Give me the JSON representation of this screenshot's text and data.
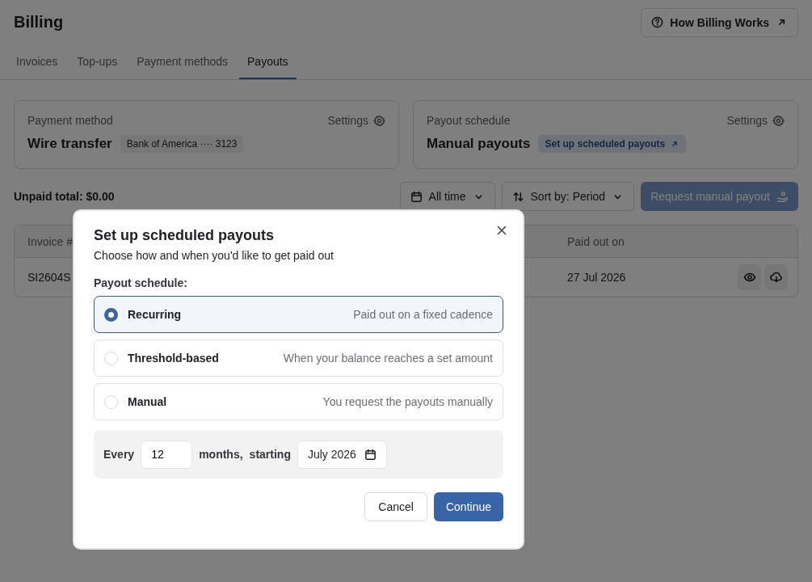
{
  "page": {
    "title": "Billing",
    "help_button": "How Billing Works"
  },
  "tabs": [
    {
      "label": "Invoices",
      "selected": false
    },
    {
      "label": "Top-ups",
      "selected": false
    },
    {
      "label": "Payment methods",
      "selected": false
    },
    {
      "label": "Payouts",
      "selected": true
    }
  ],
  "cards": [
    {
      "label": "Payment method",
      "settings": "Settings",
      "value": "Wire transfer",
      "badge": {
        "text": "Bank of America ···· 3123",
        "kind": "plain"
      }
    },
    {
      "label": "Payout schedule",
      "settings": "Settings",
      "value": "Manual payouts",
      "badge": {
        "text": "Set up scheduled payouts",
        "kind": "link"
      }
    }
  ],
  "toolbar": {
    "unpaid_total": "Unpaid total: $0.00",
    "date_filter": "All time",
    "sort": "Sort by: Period",
    "request_button": {
      "label": "Request manual payout",
      "disabled": true
    }
  },
  "table": {
    "columns": [
      "Invoice #",
      "Paid out on"
    ],
    "rows": [
      {
        "cells": [
          "SI2604S",
          "27 Jul 2026"
        ]
      }
    ]
  },
  "dialog": {
    "title": "Set up scheduled payouts",
    "subtitle": "Choose how and when you'd like to get paid out",
    "schedule_label": "Payout schedule:",
    "options": [
      {
        "label": "Recurring",
        "description": "Paid out on a fixed cadence",
        "selected": true
      },
      {
        "label": "Threshold-based",
        "description": "When your balance reaches a set amount",
        "selected": false
      },
      {
        "label": "Manual",
        "description": "You request the payouts manually",
        "selected": false
      }
    ],
    "cadence": {
      "every_label": "Every",
      "interval": "12",
      "unit_label": "months,",
      "starting_label": "starting",
      "start_date": "July 2026"
    },
    "buttons": {
      "cancel": "Cancel",
      "continue": "Continue"
    }
  }
}
